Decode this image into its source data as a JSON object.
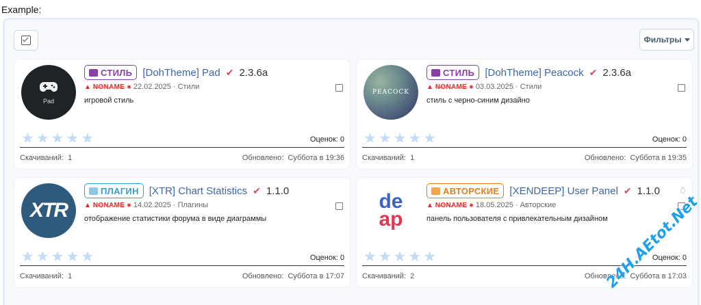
{
  "example_label": "Example:",
  "toolbar": {
    "filters_label": "Фильтры"
  },
  "cards": [
    {
      "badge": "СТИЛЬ",
      "badge_color": "#8a3fa8",
      "title": "[DohTheme] Pad",
      "version": "2.3.6a",
      "author": "NONAME",
      "date": "22.02.2025",
      "category": "Стили",
      "description": "игровой стиль",
      "avatar_text": "Pad",
      "ratings_label": "Оценок: 0",
      "downloads_label": "Скачиваний:",
      "downloads": "1",
      "updated_label": "Обновлено:",
      "updated": "Суббота в 19:36"
    },
    {
      "badge": "СТИЛЬ",
      "badge_color": "#8a3fa8",
      "title": "[DohTheme] Peacock",
      "version": "2.3.6a",
      "author": "NONAME",
      "date": "03.03.2025",
      "category": "Стили",
      "description": "стиль с черно-синим дизайно",
      "avatar_text": "PEACOCK",
      "ratings_label": "Оценок: 0",
      "downloads_label": "Скачиваний:",
      "downloads": "1",
      "updated_label": "Обновлено:",
      "updated": "Суббота в 19:35"
    },
    {
      "badge": "ПЛАГИН",
      "badge_color": "#3a9ad0",
      "title": "[XTR] Chart Statistics",
      "version": "1.1.0",
      "author": "NONAME",
      "date": "14.02.2025",
      "category": "Плагины",
      "description": "отображение статистики форума в виде диаграммы",
      "avatar_text": "XTR",
      "ratings_label": "Оценок: 0",
      "downloads_label": "Скачиваний:",
      "downloads": "1",
      "updated_label": "Обновлено:",
      "updated": "Суббота в 17:07"
    },
    {
      "badge": "АВТОРСКИЕ",
      "badge_color": "#e07d1e",
      "title": "[XENDEEP] User Panel",
      "version": "1.1.0",
      "author": "NONAME",
      "date": "18.05.2025",
      "category": "Авторские",
      "description": "панель пользователя с привлекательным дизайном",
      "avatar_line1": "de",
      "avatar_line2": "ap",
      "ratings_label": "Оценок: 0",
      "downloads_label": "Скачиваний:",
      "downloads": "2",
      "updated_label": "Обновлено:",
      "updated": "Суббота в 17:03"
    }
  ],
  "watermark": "24H.AEtot.Net"
}
